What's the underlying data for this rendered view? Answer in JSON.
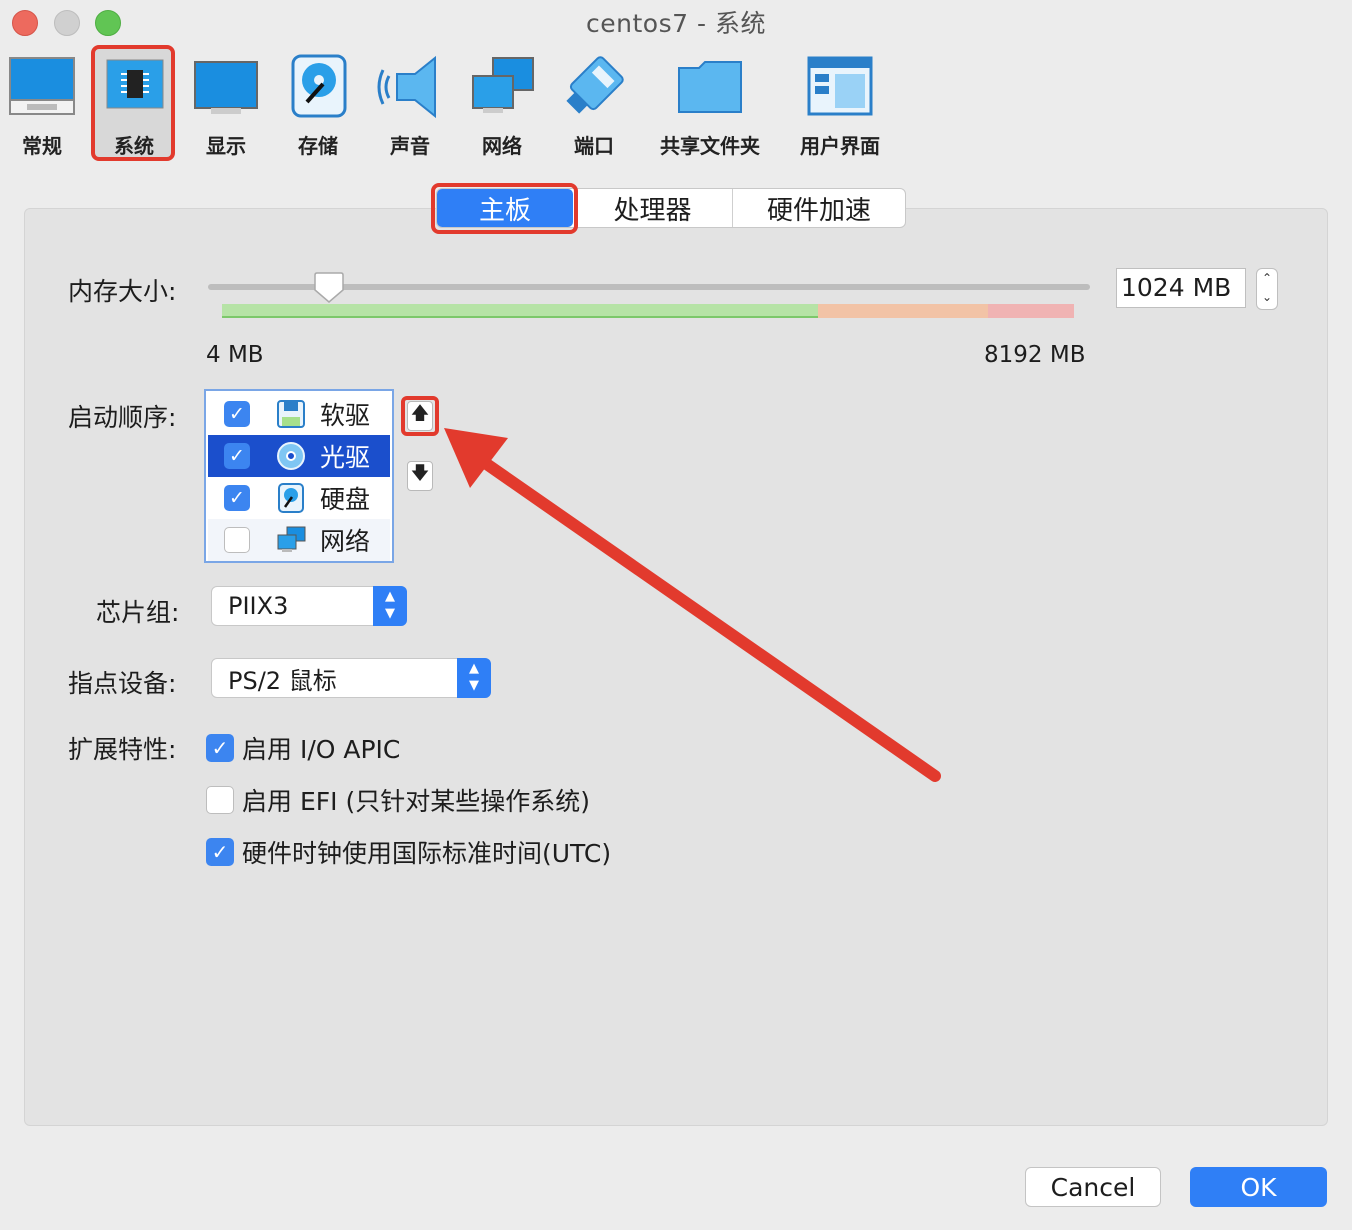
{
  "window": {
    "title": "centos7 - 系统"
  },
  "toolbar": {
    "items": [
      {
        "label": "常规",
        "icon": "monitor-icon"
      },
      {
        "label": "系统",
        "icon": "chip-icon",
        "selected": true
      },
      {
        "label": "显示",
        "icon": "display-icon"
      },
      {
        "label": "存储",
        "icon": "disk-icon"
      },
      {
        "label": "声音",
        "icon": "speaker-icon"
      },
      {
        "label": "网络",
        "icon": "network-icon"
      },
      {
        "label": "端口",
        "icon": "port-icon"
      },
      {
        "label": "共享文件夹",
        "icon": "folder-icon"
      },
      {
        "label": "用户界面",
        "icon": "window-icon"
      }
    ]
  },
  "tabs": [
    {
      "label": "主板",
      "selected": true
    },
    {
      "label": "处理器"
    },
    {
      "label": "硬件加速"
    }
  ],
  "memory": {
    "label": "内存大小:",
    "value": "1024 MB",
    "min_label": "4 MB",
    "max_label": "8192 MB",
    "fraction": 0.125
  },
  "boot": {
    "label": "启动顺序:",
    "items": [
      {
        "label": "软驱",
        "checked": true,
        "icon": "floppy-icon"
      },
      {
        "label": "光驱",
        "checked": true,
        "icon": "optical-disc-icon",
        "selected": true
      },
      {
        "label": "硬盘",
        "checked": true,
        "icon": "hard-disk-icon"
      },
      {
        "label": "网络",
        "checked": false,
        "icon": "network-icon"
      }
    ],
    "up_glyph": "🡅",
    "down_glyph": "🡇"
  },
  "chipset": {
    "label": "芯片组:",
    "value": "PIIX3"
  },
  "pointing": {
    "label": "指点设备:",
    "value": "PS/2 鼠标"
  },
  "extended": {
    "label": "扩展特性:",
    "options": [
      {
        "label": "启用 I/O APIC",
        "checked": true
      },
      {
        "label": "启用 EFI (只针对某些操作系统)",
        "checked": false
      },
      {
        "label": "硬件时钟使用国际标准时间(UTC)",
        "checked": true
      }
    ]
  },
  "buttons": {
    "cancel": "Cancel",
    "ok": "OK"
  },
  "colors": {
    "accent": "#2f7ff6",
    "highlight": "#e23a2d",
    "selection": "#1b4fcc"
  }
}
